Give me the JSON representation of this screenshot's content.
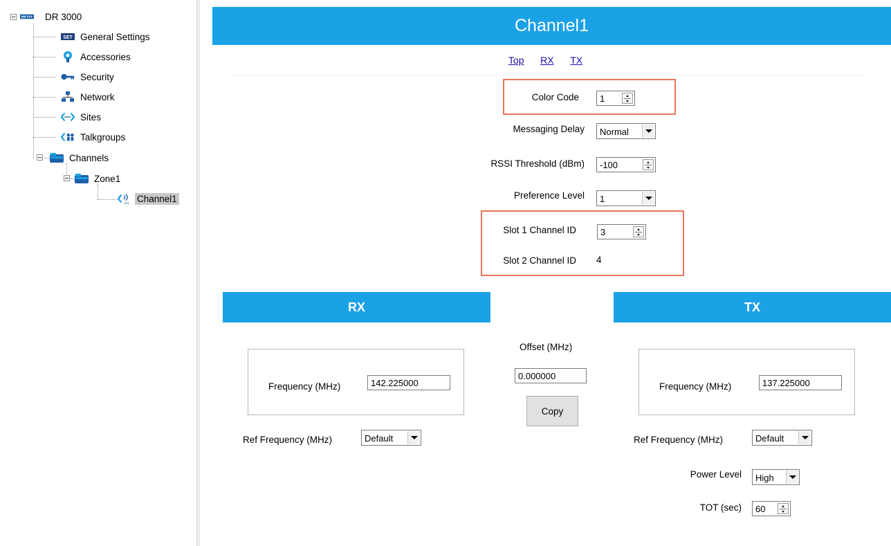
{
  "tree": {
    "root": "DR 3000",
    "items": [
      {
        "label": "General Settings",
        "icon": "settings-icon"
      },
      {
        "label": "Accessories",
        "icon": "accessories-icon"
      },
      {
        "label": "Security",
        "icon": "key-icon"
      },
      {
        "label": "Network",
        "icon": "network-icon"
      },
      {
        "label": "Sites",
        "icon": "sites-icon"
      },
      {
        "label": "Talkgroups",
        "icon": "talkgroups-icon"
      }
    ],
    "channels": "Channels",
    "zone": "Zone1",
    "channel": "Channel1"
  },
  "main": {
    "title": "Channel1",
    "nav": [
      "Top",
      "RX",
      "TX"
    ],
    "color_code": {
      "label": "Color Code",
      "value": "1"
    },
    "messaging_delay": {
      "label": "Messaging Delay",
      "value": "Normal"
    },
    "rssi_threshold": {
      "label": "RSSI Threshold (dBm)",
      "value": "-100"
    },
    "preference_level": {
      "label": "Preference Level",
      "value": "1"
    },
    "slot1_channel_id": {
      "label": "Slot 1 Channel ID",
      "value": "3"
    },
    "slot2_channel_id": {
      "label": "Slot 2 Channel ID",
      "value": "4"
    }
  },
  "rx": {
    "title": "RX",
    "frequency_label": "Frequency (MHz)",
    "frequency_value": "142.225000",
    "ref_frequency_label": "Ref Frequency (MHz)",
    "ref_frequency_value": "Default"
  },
  "offset": {
    "label": "Offset (MHz)",
    "value": "0.000000",
    "copy_button": "Copy"
  },
  "tx": {
    "title": "TX",
    "frequency_label": "Frequency (MHz)",
    "frequency_value": "137.225000",
    "ref_frequency_label": "Ref Frequency (MHz)",
    "ref_frequency_value": "Default",
    "power_level_label": "Power Level",
    "power_level_value": "High",
    "tot_label": "TOT (sec)",
    "tot_value": "60"
  },
  "colors": {
    "accent_blue": "#1ba1e6",
    "highlight_orange": "#e8735b"
  }
}
